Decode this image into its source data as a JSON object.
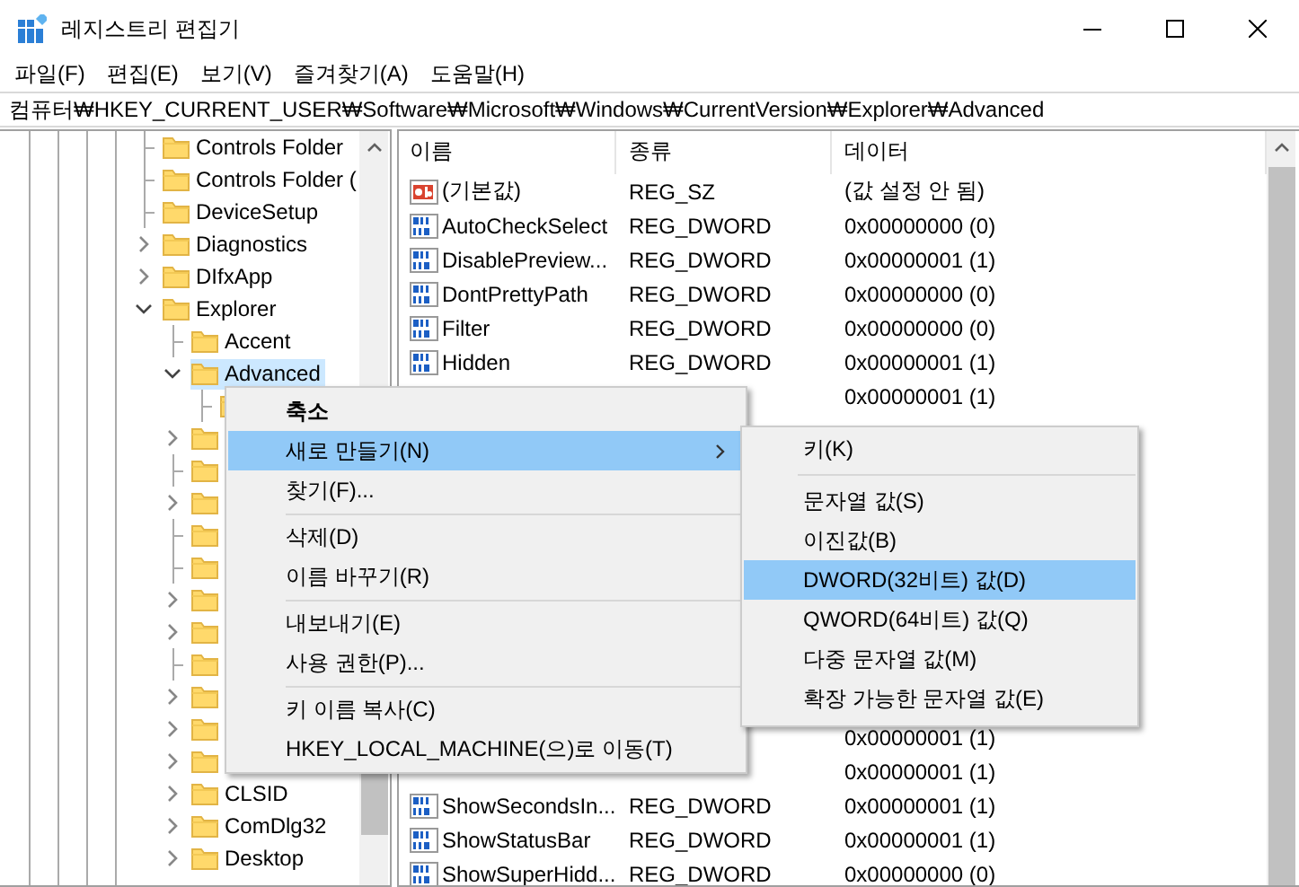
{
  "window": {
    "title": "레지스트리 편집기"
  },
  "menu_bar": [
    "파일(F)",
    "편집(E)",
    "보기(V)",
    "즐겨찾기(A)",
    "도움말(H)"
  ],
  "address": "컴퓨터₩HKEY_CURRENT_USER₩Software₩Microsoft₩Windows₩CurrentVersion₩Explorer₩Advanced",
  "tree": [
    {
      "label": "Controls Folder",
      "selected": false
    },
    {
      "label": "Controls Folder (",
      "selected": false
    },
    {
      "label": "DeviceSetup",
      "selected": false
    },
    {
      "label": "Diagnostics",
      "expanded": false,
      "selected": false
    },
    {
      "label": "DIfxApp",
      "expanded": false,
      "selected": false
    },
    {
      "label": "Explorer",
      "expanded": true,
      "selected": false,
      "children": [
        {
          "label": "Accent",
          "selected": false
        },
        {
          "label": "Advanced",
          "expanded": true,
          "selected": true,
          "children": [
            {
              "selected": false
            }
          ]
        },
        {
          "expanded": false,
          "selected": false
        },
        {
          "selected": false
        },
        {
          "expanded": false,
          "selected": false
        },
        {
          "selected": false
        },
        {
          "selected": false
        },
        {
          "expanded": false,
          "selected": false
        },
        {
          "expanded": false,
          "selected": false
        },
        {
          "selected": false
        },
        {
          "expanded": false,
          "selected": false
        },
        {
          "expanded": false,
          "selected": false
        },
        {
          "expanded": false,
          "selected": false
        },
        {
          "label": "CLSID",
          "expanded": false,
          "selected": false
        },
        {
          "label": "ComDlg32",
          "expanded": false,
          "selected": false
        },
        {
          "label": "Desktop",
          "expanded": false,
          "selected": false
        }
      ]
    }
  ],
  "list": {
    "columns": [
      "이름",
      "종류",
      "데이터"
    ],
    "rows": [
      {
        "kind": "string",
        "name": "(기본값)",
        "type": "REG_SZ",
        "data": "(값 설정 안 됨)"
      },
      {
        "kind": "dword",
        "name": "AutoCheckSelect",
        "type": "REG_DWORD",
        "data": "0x00000000 (0)"
      },
      {
        "kind": "dword",
        "name": "DisablePreview...",
        "type": "REG_DWORD",
        "data": "0x00000001 (1)"
      },
      {
        "kind": "dword",
        "name": "DontPrettyPath",
        "type": "REG_DWORD",
        "data": "0x00000000 (0)"
      },
      {
        "kind": "dword",
        "name": "Filter",
        "type": "REG_DWORD",
        "data": "0x00000000 (0)"
      },
      {
        "kind": "dword",
        "name": "Hidden",
        "type": "REG_DWORD",
        "data": "0x00000001 (1)"
      },
      {
        "kind": "covered",
        "data": "0x00000001 (1)"
      },
      {
        "kind": "covered"
      },
      {
        "kind": "covered"
      },
      {
        "kind": "covered"
      },
      {
        "kind": "covered"
      },
      {
        "kind": "covered"
      },
      {
        "kind": "covered"
      },
      {
        "kind": "covered"
      },
      {
        "kind": "covered"
      },
      {
        "kind": "covered"
      },
      {
        "kind": "covered",
        "data": "0x00000001 (1)"
      },
      {
        "kind": "covered",
        "data": "0x00000001 (1)"
      },
      {
        "kind": "dword",
        "name": "ShowSecondsIn...",
        "type": "REG_DWORD",
        "data": "0x00000001 (1)"
      },
      {
        "kind": "dword",
        "name": "ShowStatusBar",
        "type": "REG_DWORD",
        "data": "0x00000001 (1)"
      },
      {
        "kind": "dword",
        "name": "ShowSuperHidd...",
        "type": "REG_DWORD",
        "data": "0x00000000 (0)"
      }
    ]
  },
  "context_menu": {
    "items": [
      {
        "kind": "item",
        "label": "축소",
        "default": true,
        "has_submenu": false,
        "selected": false
      },
      {
        "kind": "item",
        "label": "새로 만들기(N)",
        "default": false,
        "has_submenu": true,
        "selected": true
      },
      {
        "kind": "item",
        "label": "찾기(F)...",
        "default": false,
        "has_submenu": false,
        "selected": false
      },
      {
        "kind": "separator"
      },
      {
        "kind": "item",
        "label": "삭제(D)",
        "default": false,
        "has_submenu": false,
        "selected": false
      },
      {
        "kind": "item",
        "label": "이름 바꾸기(R)",
        "default": false,
        "has_submenu": false,
        "selected": false
      },
      {
        "kind": "separator"
      },
      {
        "kind": "item",
        "label": "내보내기(E)",
        "default": false,
        "has_submenu": false,
        "selected": false
      },
      {
        "kind": "item",
        "label": "사용 권한(P)...",
        "default": false,
        "has_submenu": false,
        "selected": false
      },
      {
        "kind": "separator"
      },
      {
        "kind": "item",
        "label": "키 이름 복사(C)",
        "default": false,
        "has_submenu": false,
        "selected": false
      },
      {
        "kind": "item",
        "label": "HKEY_LOCAL_MACHINE(으)로 이동(T)",
        "default": false,
        "has_submenu": false,
        "selected": false
      }
    ]
  },
  "submenu": {
    "items": [
      {
        "kind": "item",
        "label": "키(K)",
        "selected": false
      },
      {
        "kind": "separator"
      },
      {
        "kind": "item",
        "label": "문자열 값(S)",
        "selected": false
      },
      {
        "kind": "item",
        "label": "이진값(B)",
        "selected": false
      },
      {
        "kind": "item",
        "label": "DWORD(32비트) 값(D)",
        "selected": true
      },
      {
        "kind": "item",
        "label": "QWORD(64비트) 값(Q)",
        "selected": false
      },
      {
        "kind": "item",
        "label": "다중 문자열 값(M)",
        "selected": false
      },
      {
        "kind": "item",
        "label": "확장 가능한 문자열 값(E)",
        "selected": false
      }
    ]
  }
}
